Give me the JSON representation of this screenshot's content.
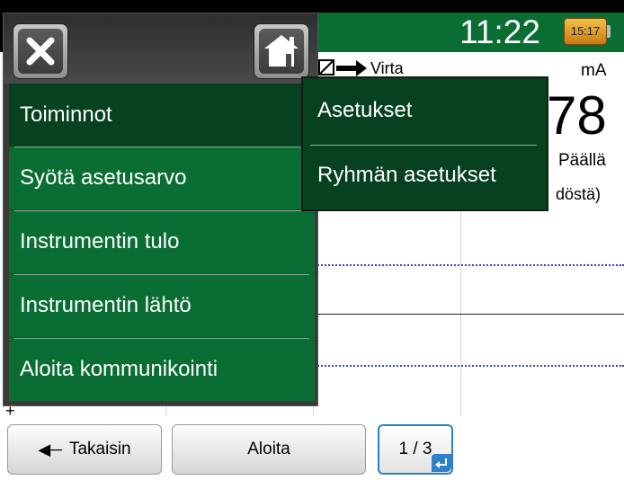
{
  "status_bar": {
    "clock": "11:22",
    "battery_time": "15:17"
  },
  "channel": {
    "label": "Virta",
    "unit": "mA",
    "value_partial": "78",
    "state": "Päällä",
    "sub_label_partial": "döstä)"
  },
  "softkeys": {
    "back_label": "Takaisin",
    "start_label": "Aloita",
    "page_label": "1 / 3"
  },
  "menu": {
    "items": [
      {
        "label": "Toiminnot",
        "selected": true
      },
      {
        "label": "Syötä asetusarvo",
        "selected": false
      },
      {
        "label": "Instrumentin tulo",
        "selected": false
      },
      {
        "label": "Instrumentin lähtö",
        "selected": false
      },
      {
        "label": "Aloita kommunikointi",
        "selected": false
      }
    ]
  },
  "submenu": {
    "items": [
      {
        "label": "Asetukset"
      },
      {
        "label": "Ryhmän asetukset"
      }
    ]
  },
  "colors": {
    "menu_green": "#0a6e34",
    "menu_selected": "#06421f",
    "accent_blue": "#2c7fc8"
  }
}
